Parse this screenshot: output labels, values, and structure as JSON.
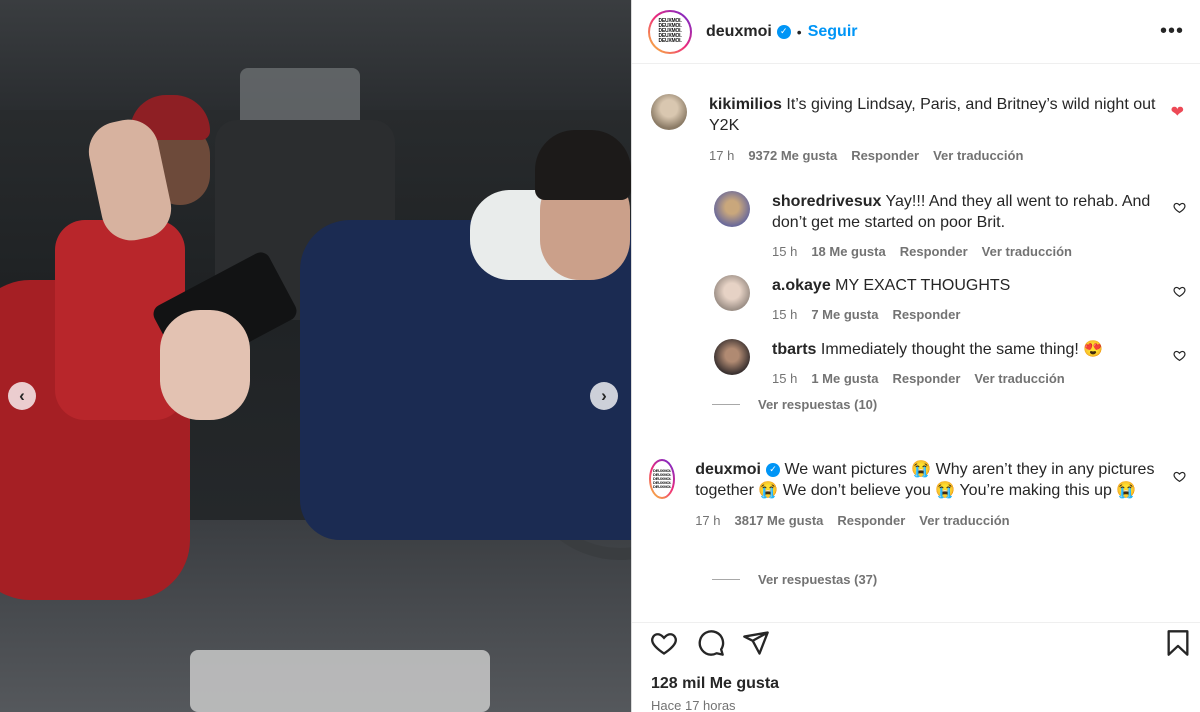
{
  "post": {
    "username": "deuxmoi",
    "follow_label": "Seguir",
    "dot": "•",
    "more_label": "•••",
    "avatar_lines": [
      "DEUXMOI.",
      "DEUXMOI.",
      "DEUXMOI.",
      "DEUXMOI.",
      "DEUXMOI."
    ]
  },
  "photo": {
    "prev_label": "‹",
    "next_label": "›"
  },
  "comments": [
    {
      "user": "kikimilios",
      "text": "It’s giving Lindsay, Paris, and Britney’s wild night out Y2K",
      "time": "17 h",
      "likes": "9372 Me gusta",
      "reply": "Responder",
      "translate": "Ver traducción",
      "liked": true
    },
    {
      "user": "shoredrivesux",
      "text": "Yay!!! And they all went to rehab. And don’t get me started on poor Brit.",
      "time": "15 h",
      "likes": "18 Me gusta",
      "reply": "Responder",
      "translate": "Ver traducción"
    },
    {
      "user": "a.okaye",
      "text": "MY EXACT THOUGHTS",
      "time": "15 h",
      "likes": "7 Me gusta",
      "reply": "Responder"
    },
    {
      "user": "tbarts",
      "text": "Immediately thought the same thing! 😍",
      "time": "15 h",
      "likes": "1 Me gusta",
      "reply": "Responder",
      "translate": "Ver traducción"
    },
    {
      "user": "deuxmoi",
      "text": "We want pictures 😭 Why aren’t they in any pictures together 😭 We don’t believe you 😭 You’re making this up 😭",
      "time": "17 h",
      "likes": "3817 Me gusta",
      "reply": "Responder",
      "translate": "Ver traducción"
    }
  ],
  "replies": [
    {
      "label": "Ver respuestas (10)"
    },
    {
      "label": "Ver respuestas (37)"
    }
  ],
  "footer": {
    "likes": "128 mil Me gusta",
    "time": "Hace 17 horas"
  },
  "colors": {
    "accent": "#0095f6",
    "liked": "#ed4956",
    "muted": "#737373"
  }
}
